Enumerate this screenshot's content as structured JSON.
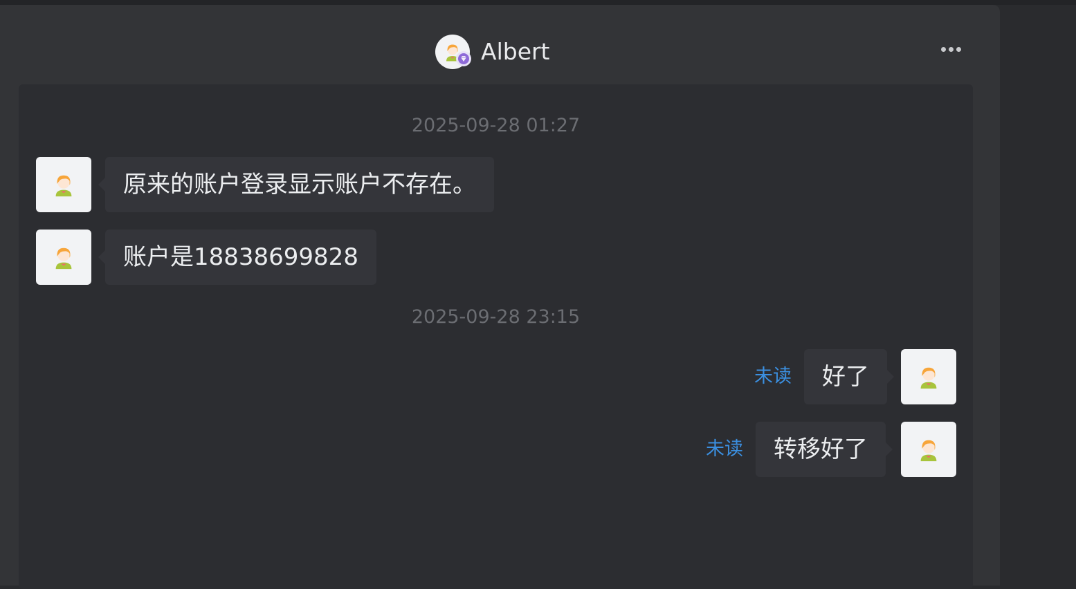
{
  "header": {
    "contact_name": "Albert",
    "avatar_icon": "user-avatar-icon",
    "badge_icon": "vip-diamond-icon",
    "more_icon": "more-dots-icon"
  },
  "messages": [
    {
      "type": "timestamp",
      "text": "2025-09-28 01:27"
    },
    {
      "type": "incoming",
      "text": "原来的账户登录显示账户不存在。"
    },
    {
      "type": "incoming",
      "text": "账户是18838699828"
    },
    {
      "type": "timestamp",
      "text": "2025-09-28 23:15"
    },
    {
      "type": "outgoing",
      "text": "好了",
      "status": "未读"
    },
    {
      "type": "outgoing",
      "text": "转移好了",
      "status": "未读"
    }
  ],
  "colors": {
    "background": "#2a2b2e",
    "panel": "#333437",
    "chat_area": "#2c2d31",
    "bubble": "#34353a",
    "unread": "#3b8fe0",
    "timestamp": "#6b6d72"
  }
}
